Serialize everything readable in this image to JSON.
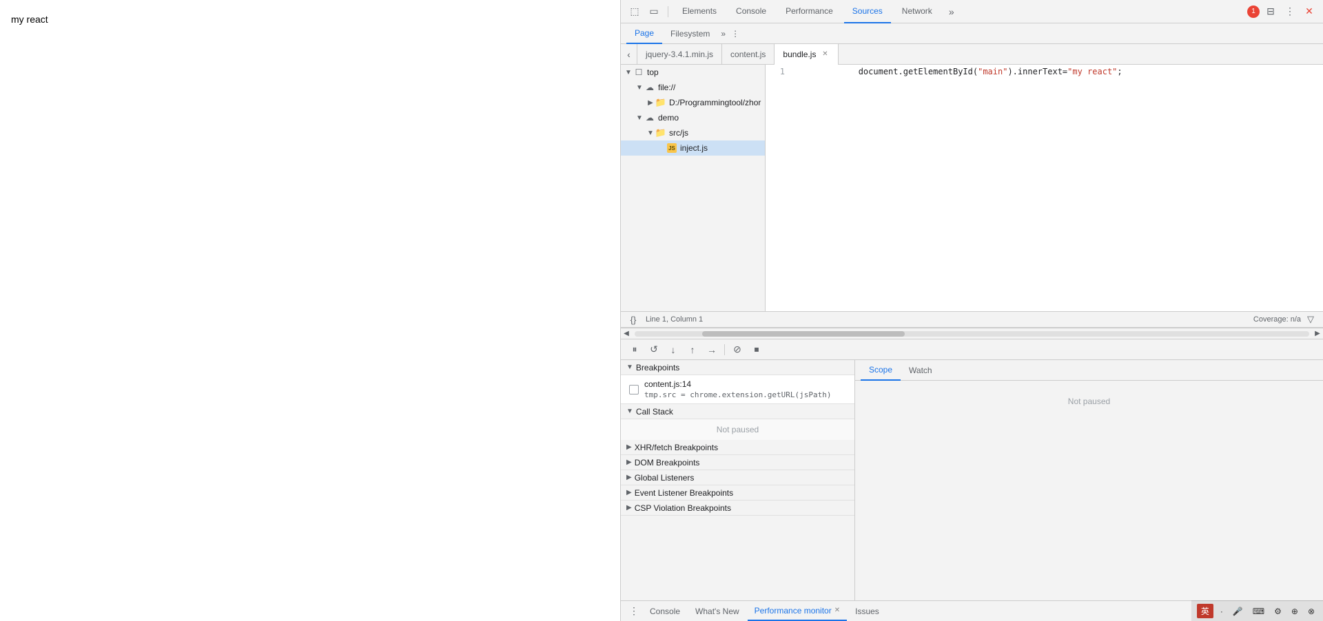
{
  "page": {
    "title": "my react"
  },
  "devtools": {
    "tabs": [
      {
        "label": "Elements",
        "active": false
      },
      {
        "label": "Console",
        "active": false
      },
      {
        "label": "Performance",
        "active": false
      },
      {
        "label": "Sources",
        "active": true
      },
      {
        "label": "Network",
        "active": false
      }
    ],
    "overflow_label": "»",
    "icons": {
      "dock": "⊟",
      "more": "⋮",
      "inspect": "⬚",
      "device": "▭"
    },
    "error_count": "1",
    "settings_icon": "⚙",
    "close_icon": "✕"
  },
  "panel_tabs": {
    "page_label": "Page",
    "filesystem_label": "Filesystem",
    "overflow": "»"
  },
  "file_tabs": {
    "jquery_label": "jquery-3.4.1.min.js",
    "content_label": "content.js",
    "bundle_label": "bundle.js",
    "collapse_icon": "‹"
  },
  "file_tree": {
    "top_label": "top",
    "file_label": "file://",
    "d_path_label": "D:/Programmingtool/zhor",
    "demo_label": "demo",
    "srcjs_label": "src/js",
    "inject_label": "inject.js"
  },
  "code": {
    "line1_number": "1",
    "line1_code": "document.getElementById(",
    "line1_string1": "\"main\"",
    "line1_mid": ").innerText=",
    "line1_string2": "\"my react\"",
    "line1_end": ";"
  },
  "status_bar": {
    "format_icon": "{}",
    "position": "Line 1, Column 1",
    "coverage": "Coverage: n/a",
    "expand_icon": "▽"
  },
  "debug_toolbar": {
    "pause_icon": "⏸",
    "step_over_icon": "↺",
    "step_into_icon": "↓",
    "step_out_icon": "↑",
    "step_icon": "→",
    "deactivate_icon": "⊘",
    "stop_icon": "⏹"
  },
  "debug_tabs": {
    "scope_label": "Scope",
    "watch_label": "Watch"
  },
  "debug_sections": {
    "breakpoints_label": "Breakpoints",
    "call_stack_label": "Call Stack",
    "xhr_label": "XHR/fetch Breakpoints",
    "dom_label": "DOM Breakpoints",
    "global_label": "Global Listeners",
    "event_label": "Event Listener Breakpoints",
    "csp_label": "CSP Violation Breakpoints",
    "not_paused": "Not paused"
  },
  "breakpoint": {
    "file": "content.js:14",
    "code": "tmp.src = chrome.extension.getURL(jsPath)"
  },
  "scope_panel": {
    "not_paused": "Not paused"
  },
  "bottom_bar": {
    "dots_icon": "⋮",
    "console_label": "Console",
    "whats_new_label": "What's New",
    "performance_monitor_label": "Performance monitor",
    "issues_label": "Issues"
  },
  "ime": {
    "label": "英",
    "dot": "·",
    "mic": "🎤",
    "keyboard": "⌨",
    "settings": "⚙",
    "more1": "⊕",
    "more2": "⊗"
  }
}
